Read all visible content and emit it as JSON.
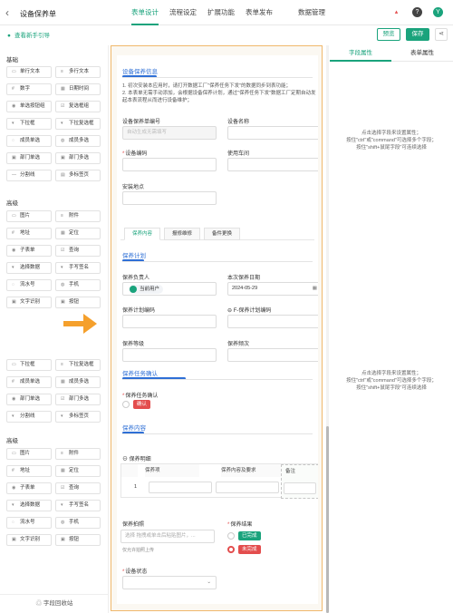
{
  "header": {
    "back_icon": "chevron-left-icon",
    "title": "设备保养单",
    "tabs": [
      "表单设计",
      "流程设定",
      "扩展功能",
      "表单发布"
    ],
    "data_tab": "数据管理",
    "avatar": "Y"
  },
  "toolbar": {
    "guide": "查看新手引导",
    "preview": "预览",
    "save": "保存"
  },
  "left": {
    "basic_title": "基础",
    "basic": [
      [
        "单行文本",
        "多行文本"
      ],
      [
        "数字",
        "日期时间"
      ],
      [
        "单选按钮组",
        "复选框组"
      ],
      [
        "下拉框",
        "下拉复选框"
      ],
      [
        "成员单选",
        "成员多选"
      ],
      [
        "部门单选",
        "部门多选"
      ],
      [
        "分割线",
        "多标签页"
      ]
    ],
    "advanced_title": "高级",
    "advanced": [
      [
        "图片",
        "附件"
      ],
      [
        "地址",
        "定位"
      ],
      [
        "子表单",
        "查询"
      ],
      [
        "选择数据",
        "手写签名"
      ],
      [
        "流水号",
        "手机"
      ],
      [
        "文字识别",
        "按钮"
      ]
    ],
    "basic2": [
      [
        "下拉框",
        "下拉复选框"
      ],
      [
        "成员单选",
        "成员多选"
      ],
      [
        "部门单选",
        "部门多选"
      ],
      [
        "分割线",
        "多标签页"
      ]
    ],
    "advanced2_title": "高级",
    "advanced2": [
      [
        "图片",
        "附件"
      ],
      [
        "地址",
        "定位"
      ],
      [
        "子表单",
        "查询"
      ],
      [
        "选择数据",
        "手写签名"
      ],
      [
        "流水号",
        "手机"
      ],
      [
        "文字识别",
        "按钮"
      ]
    ],
    "recycle": "字段回收站"
  },
  "form": {
    "sec1": "设备保养信息",
    "desc1": "1. 初次安装本应用时，请打开数据工厂\"保养任务下发\"的数据同步到表功能；",
    "desc2": "2. 本表单无需手动添加，会根据设备保养计划，通过\"保养任务下发\"数据工厂定期自动发起本表流程从而进行设备维护；",
    "f_no": "设备保养单编号",
    "f_no_ph": "自动生成无需填写",
    "f_name": "设备名称",
    "f_code": "设备编码",
    "f_shop": "使用车间",
    "f_loc": "安装地点",
    "tabs": [
      "保养内容",
      "报修维修",
      "备件更换"
    ],
    "sec_plan": "保养计划",
    "f_owner": "保养负责人",
    "owner_value": "当前用户",
    "f_date": "本次保养日期",
    "date_value": "2024-05-29",
    "f_plan_code": "保养计划编码",
    "f_plan_code2": "F-保养计划编码",
    "f_level": "保养等级",
    "f_freq": "保养频次",
    "sec_confirm": "保养任务确认",
    "f_confirm": "保养任务确认",
    "confirm_tag": "确认",
    "sec_content": "保养内容",
    "f_detail": "保养明细",
    "cols": [
      "保养项",
      "保养内容及要求",
      "备注"
    ],
    "row_no": "1",
    "f_photo": "保养拍照",
    "photo_ph": "选择  拖拽或单击后粘贴图片，...",
    "photo_hint": "仅允许拍照上传",
    "f_result": "保养结果",
    "result_opts": [
      "已完成",
      "未完成"
    ],
    "f_status": "设备状态"
  },
  "right": {
    "tabs": [
      "字段属性",
      "表单属性"
    ],
    "hint1": "点击选择字段来设置属性；",
    "hint2": "按住\"ctrl\"或\"command\"可选择多个字段；",
    "hint3": "按住\"shift+鼠尾字段\"可连续选择"
  },
  "colors": {
    "accent": "#1aa37c",
    "section": "#2e6fd6",
    "danger": "#e34d4d",
    "canvas_border": "#f0b86c",
    "arrow": "#f5a02c"
  }
}
